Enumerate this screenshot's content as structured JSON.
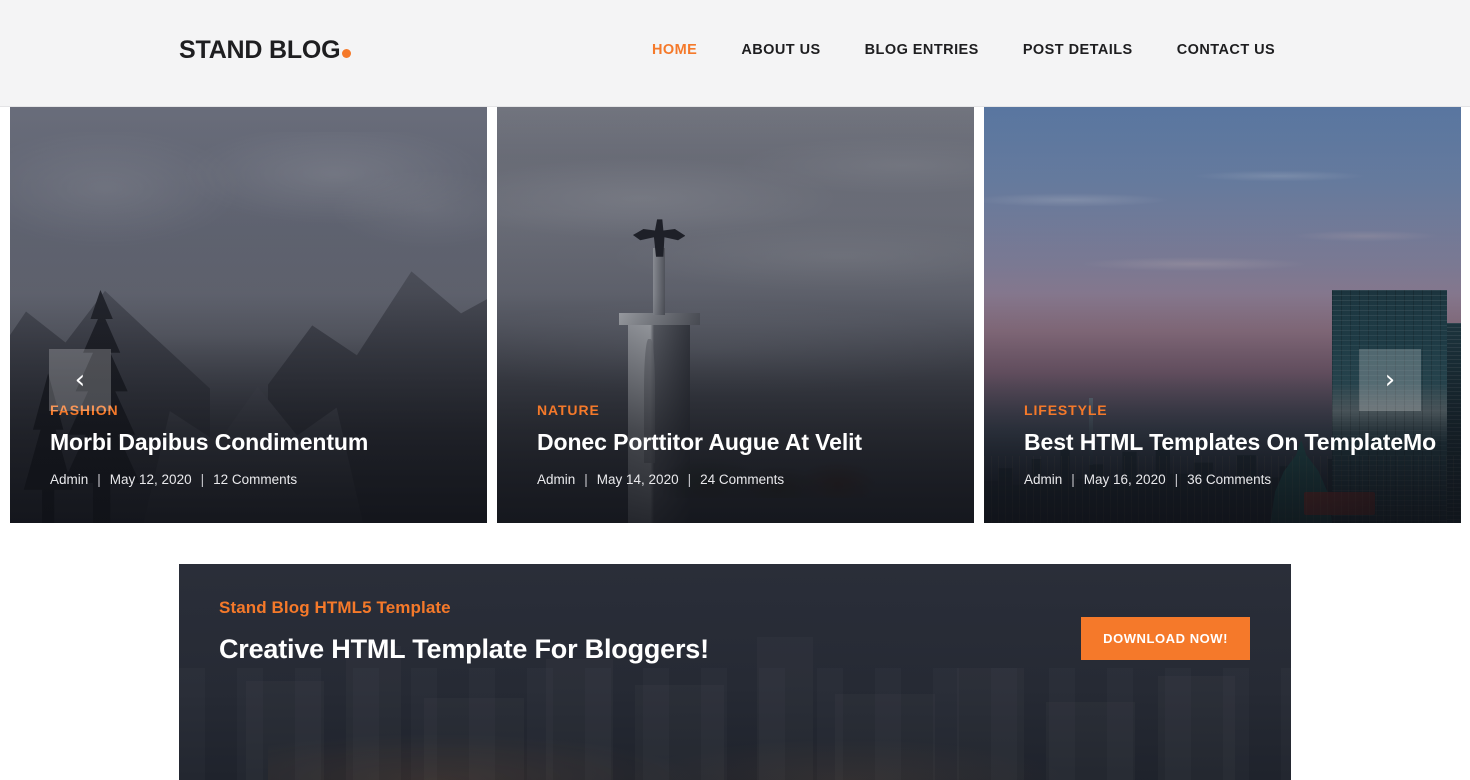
{
  "header": {
    "logo_text": "STAND BLOG",
    "logo_dot": "dot",
    "nav": [
      {
        "label": "HOME",
        "active": true
      },
      {
        "label": "ABOUT US",
        "active": false
      },
      {
        "label": "BLOG ENTRIES",
        "active": false
      },
      {
        "label": "POST DETAILS",
        "active": false
      },
      {
        "label": "CONTACT US",
        "active": false
      }
    ]
  },
  "carousel": {
    "prev_glyph": "‹",
    "next_glyph": "›",
    "slides": [
      {
        "category": "FASHION",
        "title": "Morbi Dapibus Condimentum",
        "author": "Admin",
        "date": "May 12, 2020",
        "comments": "12 Comments",
        "image_alt": "mountain-valley-with-pine-trees"
      },
      {
        "category": "NATURE",
        "title": "Donec Porttitor Augue At Velit",
        "author": "Admin",
        "date": "May 14, 2020",
        "comments": "24 Comments",
        "image_alt": "christ-statue-monument-above-clouds"
      },
      {
        "category": "LIFESTYLE",
        "title": "Best HTML Templates On TemplateMo",
        "author": "Admin",
        "date": "May 16, 2020",
        "comments": "36 Comments",
        "image_alt": "dusk-city-skyline-with-skyscrapers"
      }
    ],
    "meta_separator": "|"
  },
  "cta": {
    "subtitle": "Stand Blog HTML5 Template",
    "title": "Creative HTML Template For Bloggers!",
    "button_label": "DOWNLOAD NOW!"
  },
  "colors": {
    "accent": "#f5792a",
    "header_bg": "#f4f4f5",
    "text_dark": "#1e1e20",
    "banner_bg": "#2a2e39",
    "white": "#ffffff"
  }
}
